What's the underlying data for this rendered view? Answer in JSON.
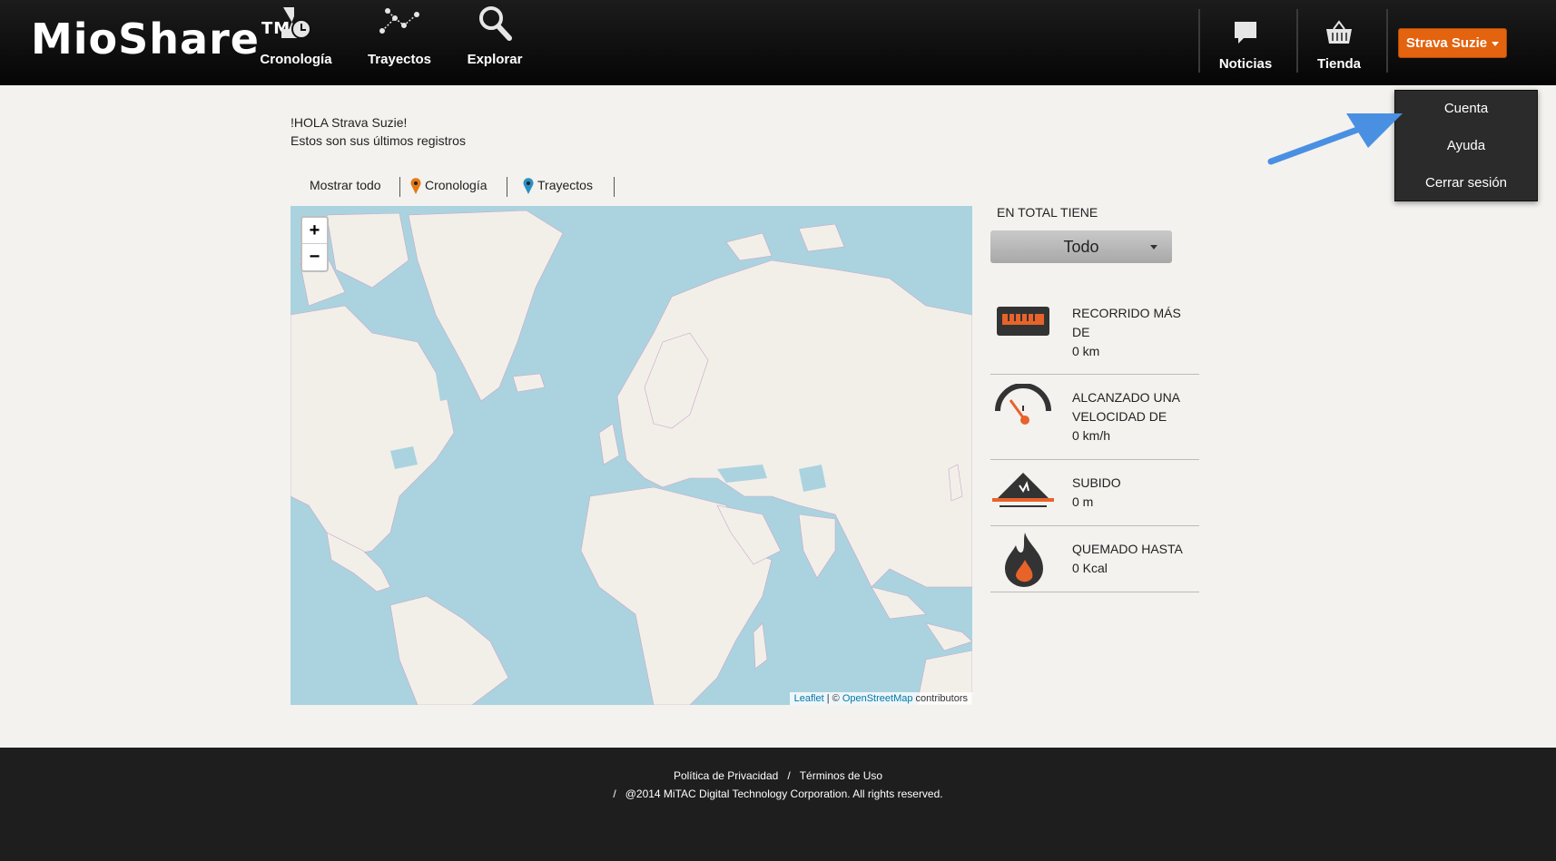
{
  "header": {
    "logo": "MioShare",
    "logo_tm": "TM",
    "nav": [
      "Cronología",
      "Trayectos",
      "Explorar"
    ],
    "news_label": "Noticias",
    "store_label": "Tienda",
    "user_button": "Strava Suzie"
  },
  "user_menu": {
    "items": [
      "Cuenta",
      "Ayuda",
      "Cerrar sesión"
    ]
  },
  "greeting": {
    "line1": "!HOLA Strava Suzie!",
    "line2": "Estos son sus últimos registros"
  },
  "filters": [
    "Mostrar todo",
    "Cronología",
    "Trayectos"
  ],
  "map": {
    "zoom_in": "+",
    "zoom_out": "−",
    "attribution_leaflet": "Leaflet",
    "attribution_sep": " | © ",
    "attribution_osm": "OpenStreetMap",
    "attribution_tail": " contributors"
  },
  "stats": {
    "title": "EN TOTAL TIENE",
    "period": "Todo",
    "items": [
      {
        "label_l1": "RECORRIDO MÁS",
        "label_l2": "DE",
        "value": "0 km",
        "icon": "odometer-icon"
      },
      {
        "label_l1": "ALCANZADO UNA",
        "label_l2": "VELOCIDAD DE",
        "value": "0 km/h",
        "icon": "speedometer-icon"
      },
      {
        "label_l1": "SUBIDO",
        "label_l2": "",
        "value": "0 m",
        "icon": "mountain-icon"
      },
      {
        "label_l1": "QUEMADO HASTA",
        "label_l2": "",
        "value": "0 Kcal",
        "icon": "flame-icon"
      }
    ]
  },
  "footer": {
    "privacy": "Política de Privacidad",
    "sep": "/",
    "terms": "Términos de Uso",
    "copyright": "@2014 MiTAC Digital Technology Corporation. All rights reserved."
  },
  "colors": {
    "accent": "#e3630f",
    "map_water": "#aad3df",
    "map_land": "#f2efe9",
    "arrow": "#4a90e2"
  }
}
